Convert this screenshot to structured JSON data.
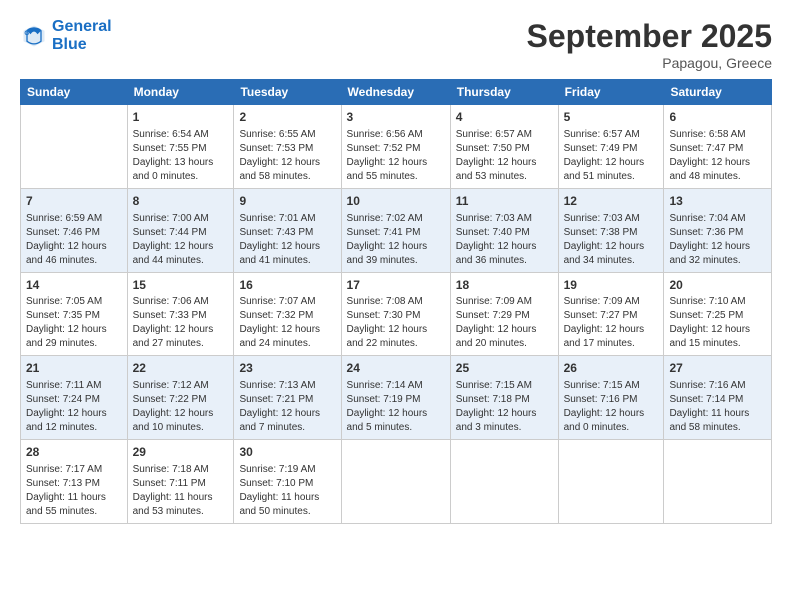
{
  "logo": {
    "line1": "General",
    "line2": "Blue"
  },
  "title": "September 2025",
  "subtitle": "Papagou, Greece",
  "weekdays": [
    "Sunday",
    "Monday",
    "Tuesday",
    "Wednesday",
    "Thursday",
    "Friday",
    "Saturday"
  ],
  "weeks": [
    [
      {
        "day": "",
        "info": ""
      },
      {
        "day": "1",
        "info": "Sunrise: 6:54 AM\nSunset: 7:55 PM\nDaylight: 13 hours\nand 0 minutes."
      },
      {
        "day": "2",
        "info": "Sunrise: 6:55 AM\nSunset: 7:53 PM\nDaylight: 12 hours\nand 58 minutes."
      },
      {
        "day": "3",
        "info": "Sunrise: 6:56 AM\nSunset: 7:52 PM\nDaylight: 12 hours\nand 55 minutes."
      },
      {
        "day": "4",
        "info": "Sunrise: 6:57 AM\nSunset: 7:50 PM\nDaylight: 12 hours\nand 53 minutes."
      },
      {
        "day": "5",
        "info": "Sunrise: 6:57 AM\nSunset: 7:49 PM\nDaylight: 12 hours\nand 51 minutes."
      },
      {
        "day": "6",
        "info": "Sunrise: 6:58 AM\nSunset: 7:47 PM\nDaylight: 12 hours\nand 48 minutes."
      }
    ],
    [
      {
        "day": "7",
        "info": "Sunrise: 6:59 AM\nSunset: 7:46 PM\nDaylight: 12 hours\nand 46 minutes."
      },
      {
        "day": "8",
        "info": "Sunrise: 7:00 AM\nSunset: 7:44 PM\nDaylight: 12 hours\nand 44 minutes."
      },
      {
        "day": "9",
        "info": "Sunrise: 7:01 AM\nSunset: 7:43 PM\nDaylight: 12 hours\nand 41 minutes."
      },
      {
        "day": "10",
        "info": "Sunrise: 7:02 AM\nSunset: 7:41 PM\nDaylight: 12 hours\nand 39 minutes."
      },
      {
        "day": "11",
        "info": "Sunrise: 7:03 AM\nSunset: 7:40 PM\nDaylight: 12 hours\nand 36 minutes."
      },
      {
        "day": "12",
        "info": "Sunrise: 7:03 AM\nSunset: 7:38 PM\nDaylight: 12 hours\nand 34 minutes."
      },
      {
        "day": "13",
        "info": "Sunrise: 7:04 AM\nSunset: 7:36 PM\nDaylight: 12 hours\nand 32 minutes."
      }
    ],
    [
      {
        "day": "14",
        "info": "Sunrise: 7:05 AM\nSunset: 7:35 PM\nDaylight: 12 hours\nand 29 minutes."
      },
      {
        "day": "15",
        "info": "Sunrise: 7:06 AM\nSunset: 7:33 PM\nDaylight: 12 hours\nand 27 minutes."
      },
      {
        "day": "16",
        "info": "Sunrise: 7:07 AM\nSunset: 7:32 PM\nDaylight: 12 hours\nand 24 minutes."
      },
      {
        "day": "17",
        "info": "Sunrise: 7:08 AM\nSunset: 7:30 PM\nDaylight: 12 hours\nand 22 minutes."
      },
      {
        "day": "18",
        "info": "Sunrise: 7:09 AM\nSunset: 7:29 PM\nDaylight: 12 hours\nand 20 minutes."
      },
      {
        "day": "19",
        "info": "Sunrise: 7:09 AM\nSunset: 7:27 PM\nDaylight: 12 hours\nand 17 minutes."
      },
      {
        "day": "20",
        "info": "Sunrise: 7:10 AM\nSunset: 7:25 PM\nDaylight: 12 hours\nand 15 minutes."
      }
    ],
    [
      {
        "day": "21",
        "info": "Sunrise: 7:11 AM\nSunset: 7:24 PM\nDaylight: 12 hours\nand 12 minutes."
      },
      {
        "day": "22",
        "info": "Sunrise: 7:12 AM\nSunset: 7:22 PM\nDaylight: 12 hours\nand 10 minutes."
      },
      {
        "day": "23",
        "info": "Sunrise: 7:13 AM\nSunset: 7:21 PM\nDaylight: 12 hours\nand 7 minutes."
      },
      {
        "day": "24",
        "info": "Sunrise: 7:14 AM\nSunset: 7:19 PM\nDaylight: 12 hours\nand 5 minutes."
      },
      {
        "day": "25",
        "info": "Sunrise: 7:15 AM\nSunset: 7:18 PM\nDaylight: 12 hours\nand 3 minutes."
      },
      {
        "day": "26",
        "info": "Sunrise: 7:15 AM\nSunset: 7:16 PM\nDaylight: 12 hours\nand 0 minutes."
      },
      {
        "day": "27",
        "info": "Sunrise: 7:16 AM\nSunset: 7:14 PM\nDaylight: 11 hours\nand 58 minutes."
      }
    ],
    [
      {
        "day": "28",
        "info": "Sunrise: 7:17 AM\nSunset: 7:13 PM\nDaylight: 11 hours\nand 55 minutes."
      },
      {
        "day": "29",
        "info": "Sunrise: 7:18 AM\nSunset: 7:11 PM\nDaylight: 11 hours\nand 53 minutes."
      },
      {
        "day": "30",
        "info": "Sunrise: 7:19 AM\nSunset: 7:10 PM\nDaylight: 11 hours\nand 50 minutes."
      },
      {
        "day": "",
        "info": ""
      },
      {
        "day": "",
        "info": ""
      },
      {
        "day": "",
        "info": ""
      },
      {
        "day": "",
        "info": ""
      }
    ]
  ]
}
